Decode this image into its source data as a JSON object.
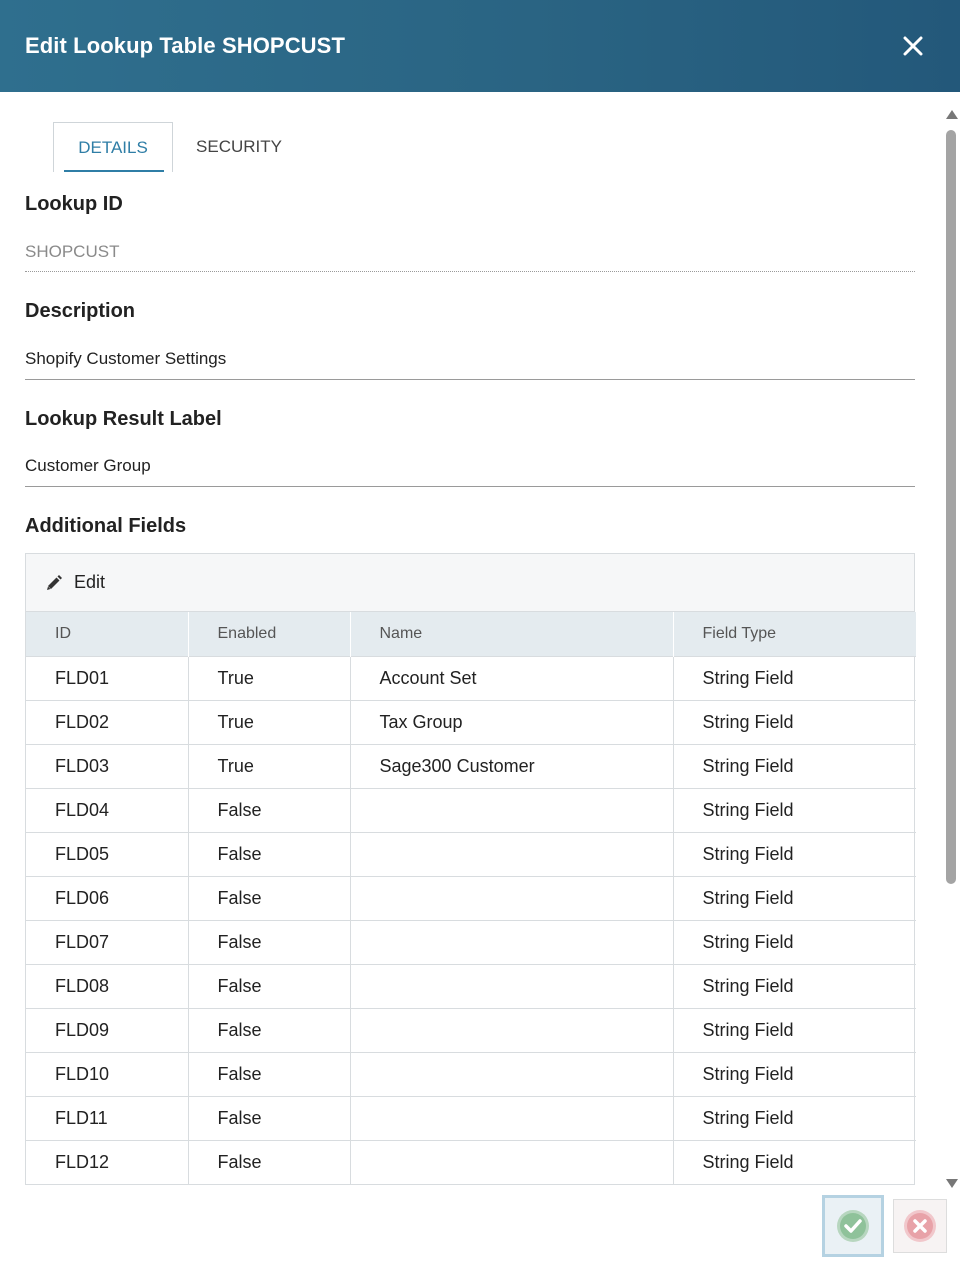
{
  "dialog": {
    "title": "Edit Lookup Table SHOPCUST",
    "accent": "#2a6483"
  },
  "tabs": [
    {
      "label": "DETAILS",
      "active": true
    },
    {
      "label": "SECURITY",
      "active": false
    }
  ],
  "fields": {
    "lookup_id": {
      "label": "Lookup ID",
      "value": "SHOPCUST"
    },
    "description": {
      "label": "Description",
      "value": "Shopify Customer Settings"
    },
    "result_label": {
      "label": "Lookup Result Label",
      "value": "Customer Group"
    },
    "additional_fields": {
      "label": "Additional Fields"
    }
  },
  "grid": {
    "toolbar": {
      "edit_label": "Edit",
      "icon": "pencil-icon"
    },
    "columns": [
      "ID",
      "Enabled",
      "Name",
      "Field Type"
    ],
    "rows": [
      [
        "FLD01",
        "True",
        "Account Set",
        "String Field"
      ],
      [
        "FLD02",
        "True",
        "Tax Group",
        "String Field"
      ],
      [
        "FLD03",
        "True",
        "Sage300 Customer",
        "String Field"
      ],
      [
        "FLD04",
        "False",
        "",
        "String Field"
      ],
      [
        "FLD05",
        "False",
        "",
        "String Field"
      ],
      [
        "FLD06",
        "False",
        "",
        "String Field"
      ],
      [
        "FLD07",
        "False",
        "",
        "String Field"
      ],
      [
        "FLD08",
        "False",
        "",
        "String Field"
      ],
      [
        "FLD09",
        "False",
        "",
        "String Field"
      ],
      [
        "FLD10",
        "False",
        "",
        "String Field"
      ],
      [
        "FLD11",
        "False",
        "",
        "String Field"
      ],
      [
        "FLD12",
        "False",
        "",
        "String Field"
      ]
    ]
  },
  "footer": {
    "ok_icon": "check-icon",
    "cancel_icon": "x-icon",
    "ok_color": "#8fc29a",
    "cancel_color": "#e8a2a8"
  }
}
